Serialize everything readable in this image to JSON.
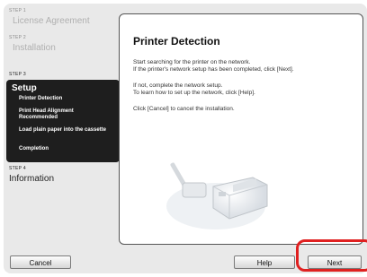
{
  "sidebar": {
    "step1_label": "STEP 1",
    "step1_title": "License Agreement",
    "step2_label": "STEP 2",
    "step2_title": "Installation",
    "step3_label": "STEP 3",
    "step3_title": "Setup",
    "step3_items": [
      "Printer Detection",
      "Print Head Alignment Recommended",
      "Load plain paper into the cassette",
      "Completion"
    ],
    "step4_label": "STEP 4",
    "step4_title": "Information"
  },
  "panel": {
    "title": "Printer Detection",
    "line1": "Start searching for the printer on the network.",
    "line2": "If the printer's network setup has been completed, click [Next].",
    "line3": "If not, complete the network setup.",
    "line4": "To learn how to set up the network, click [Help].",
    "line5": "Click [Cancel] to cancel the installation."
  },
  "buttons": {
    "cancel": "Cancel",
    "help": "Help",
    "next": "Next"
  },
  "colors": {
    "highlight": "#e02020",
    "active_step_bg": "#1e1e1e"
  }
}
